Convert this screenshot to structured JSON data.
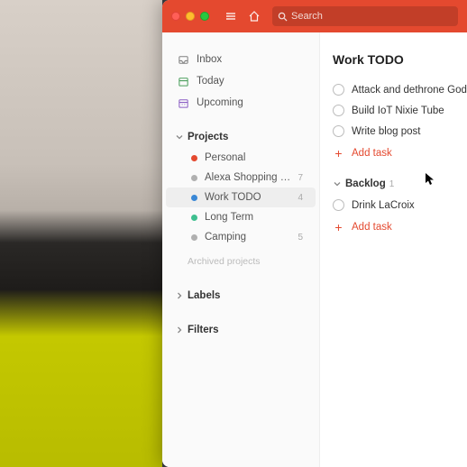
{
  "search": {
    "placeholder": "Search"
  },
  "sidebar": {
    "nav": [
      {
        "label": "Inbox"
      },
      {
        "label": "Today"
      },
      {
        "label": "Upcoming"
      }
    ],
    "projects_header": "Projects",
    "projects": [
      {
        "label": "Personal",
        "color": "#e4492f",
        "count": ""
      },
      {
        "label": "Alexa Shopping List",
        "color": "#b0b0b0",
        "count": "7"
      },
      {
        "label": "Work TODO",
        "color": "#3a88d6",
        "count": "4"
      },
      {
        "label": "Long Term",
        "color": "#3fbf8f",
        "count": ""
      },
      {
        "label": "Camping",
        "color": "#b0b0b0",
        "count": "5"
      }
    ],
    "archived": "Archived projects",
    "labels_header": "Labels",
    "filters_header": "Filters"
  },
  "main": {
    "title": "Work TODO",
    "tasks": [
      {
        "label": "Attack and dethrone God"
      },
      {
        "label": "Build IoT Nixie Tube"
      },
      {
        "label": "Write blog post"
      }
    ],
    "add_task": "Add task",
    "sections": [
      {
        "name": "Backlog",
        "count": "1",
        "tasks": [
          {
            "label": "Drink LaCroix"
          }
        ]
      }
    ]
  }
}
